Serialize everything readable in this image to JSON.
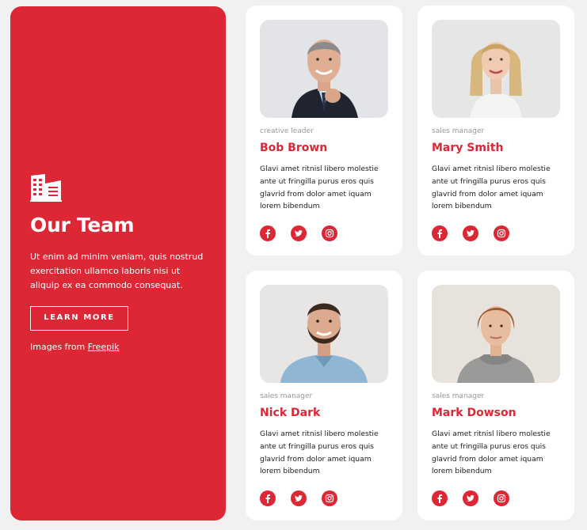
{
  "colors": {
    "accent": "#dd2734",
    "page_background": "#f1f1f1",
    "card_background": "#ffffff"
  },
  "intro": {
    "icon": "building-icon",
    "title": "Our Team",
    "text": "Ut enim ad minim veniam, quis nostrud exercitation ullamco laboris nisi ut aliquip ex ea commodo consequat.",
    "button_label": "LEARN MORE",
    "credit_prefix": "Images from",
    "credit_link": "Freepik"
  },
  "members": [
    {
      "role": "creative leader",
      "name": "Bob Brown",
      "bio": "Glavi amet ritnisl libero molestie ante ut fringilla purus eros quis glavrid from dolor amet iquam lorem bibendum",
      "photo": "man-in-dark-suit-portrait",
      "socials": [
        "facebook-icon",
        "twitter-icon",
        "instagram-icon"
      ]
    },
    {
      "role": "sales manager",
      "name": "Mary Smith",
      "bio": "Glavi amet ritnisl libero molestie ante ut fringilla purus eros quis glavrid from dolor amet iquam lorem bibendum",
      "photo": "blonde-woman-portrait",
      "socials": [
        "facebook-icon",
        "twitter-icon",
        "instagram-icon"
      ]
    },
    {
      "role": "sales manager",
      "name": "Nick Dark",
      "bio": "Glavi amet ritnisl libero molestie ante ut fringilla purus eros quis glavrid from dolor amet iquam lorem bibendum",
      "photo": "bearded-man-portrait",
      "socials": [
        "facebook-icon",
        "twitter-icon",
        "instagram-icon"
      ]
    },
    {
      "role": "sales manager",
      "name": "Mark Dowson",
      "bio": "Glavi amet ritnisl libero molestie ante ut fringilla purus eros quis glavrid from dolor amet iquam lorem bibendum",
      "photo": "young-man-hoodie-portrait",
      "socials": [
        "facebook-icon",
        "twitter-icon",
        "instagram-icon"
      ]
    }
  ]
}
